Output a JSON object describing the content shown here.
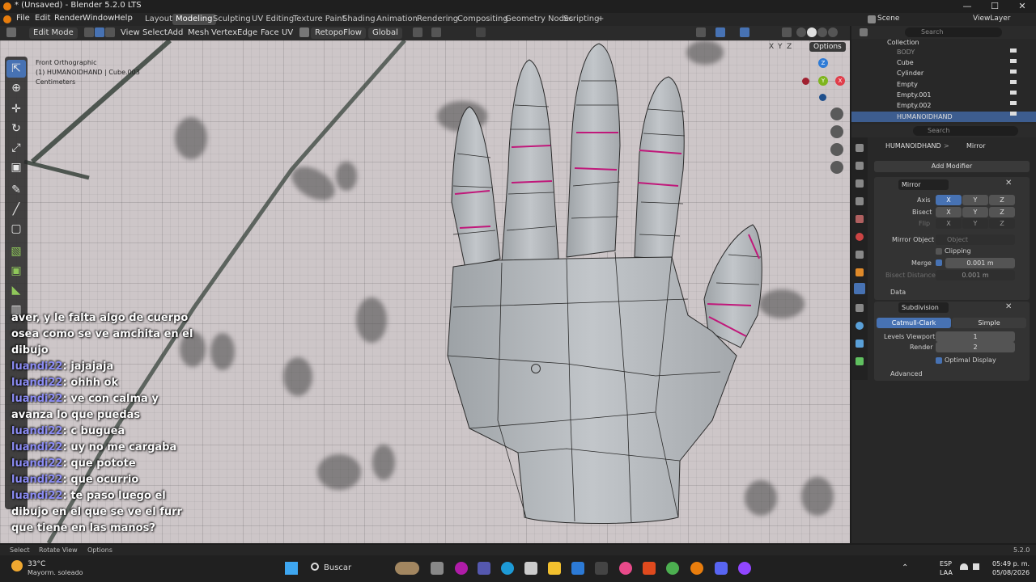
{
  "window": {
    "title": "* (Unsaved) - Blender 5.2.0 LTS",
    "controls": [
      "—",
      "☐",
      "✕"
    ]
  },
  "menu": {
    "items": [
      "File",
      "Edit",
      "Render",
      "Window",
      "Help"
    ],
    "workspaces": [
      "Layout",
      "Modeling",
      "Sculpting",
      "UV Editing",
      "Texture Paint",
      "Shading",
      "Animation",
      "Rendering",
      "Compositing",
      "Geometry Nodes",
      "Scripting"
    ],
    "active_workspace": "Modeling",
    "add_tab": "+",
    "scene": "Scene",
    "view_layer": "ViewLayer"
  },
  "viewport_header": {
    "mode": "Edit Mode",
    "menus": [
      "View",
      "Select",
      "Add",
      "Mesh",
      "Vertex",
      "Edge",
      "Face",
      "UV"
    ],
    "addon": "RetopoFlow",
    "orientation": "Global",
    "options": "Options",
    "axes": [
      "X",
      "Y",
      "Z"
    ]
  },
  "viewport": {
    "view_name": "Front Orthographic",
    "object_info": "(1) HUMANOIDHAND | Cube.003",
    "units": "Centimeters",
    "gizmo": {
      "x": "X",
      "y": "Y",
      "z": "Z"
    }
  },
  "chat": [
    {
      "user": "",
      "text": "aver, y le falta algo de cuerpo"
    },
    {
      "user": "",
      "text": "osea como se ve amchita en el"
    },
    {
      "user": "",
      "text": "dibujo"
    },
    {
      "user": "luandi22",
      "text": ": jajajaja"
    },
    {
      "user": "luandi22",
      "text": ": ohhh ok"
    },
    {
      "user": "luandi22",
      "text": ": ve con calma y"
    },
    {
      "user": "",
      "text": "avanza lo que puedas"
    },
    {
      "user": "luandi22",
      "text": ": c buguea"
    },
    {
      "user": "luandi22",
      "text": ": uy no me cargaba"
    },
    {
      "user": "luandi22",
      "text": ": que pototе"
    },
    {
      "user": "luandi22",
      "text": ": que ocurrio"
    },
    {
      "user": "luandi22",
      "text": ": te paso luego el"
    },
    {
      "user": "",
      "text": "dibujo en el que se ve el furr"
    },
    {
      "user": "",
      "text": "que tiene en las manos?"
    }
  ],
  "outliner": {
    "search_placeholder": "Search",
    "collection": "Collection",
    "items": [
      "BODY",
      "Cube",
      "Cylinder",
      "Empty",
      "Empty.001",
      "Empty.002",
      "HUMANOIDHAND"
    ],
    "selected": "HUMANOIDHAND"
  },
  "properties": {
    "search_placeholder": "Search",
    "object": "HUMANOIDHAND",
    "breadcrumb_sep": ">",
    "tab": "Mirror",
    "add_modifier": "Add Modifier",
    "mirror": {
      "name": "Mirror",
      "axis_label": "Axis",
      "bisect_label": "Bisect",
      "flip_label": "Flip",
      "axes": [
        "X",
        "Y",
        "Z"
      ],
      "mirror_object_label": "Mirror Object",
      "mirror_object_placeholder": "Object",
      "clipping": "Clipping",
      "merge_label": "Merge",
      "merge_value": "0.001 m",
      "bisect_distance_label": "Bisect Distance",
      "bisect_distance_value": "0.001 m",
      "data": "Data"
    },
    "subdivision": {
      "name": "Subdivision",
      "catmull": "Catmull-Clark",
      "simple": "Simple",
      "levels_label": "Levels Viewport",
      "levels_value": "1",
      "render_label": "Render",
      "render_value": "2",
      "optimal": "Optimal Display",
      "advanced": "Advanced"
    }
  },
  "statusbar": {
    "select": "Select",
    "rotate": "Rotate View",
    "options": "Options",
    "version": "5.2.0"
  },
  "taskbar": {
    "weather_temp": "33°C",
    "weather_desc": "Mayorm. soleado",
    "search_label": "Buscar",
    "lang": "ESP",
    "lang2": "LAA",
    "time": "05:49 p. m.",
    "date": "05/08/2026"
  },
  "colors": {
    "accent": "#4772b3",
    "edge_seam": "#c0187a",
    "viewport_bg": "#cdc6c8",
    "chat_user": "#8b8cf4"
  }
}
